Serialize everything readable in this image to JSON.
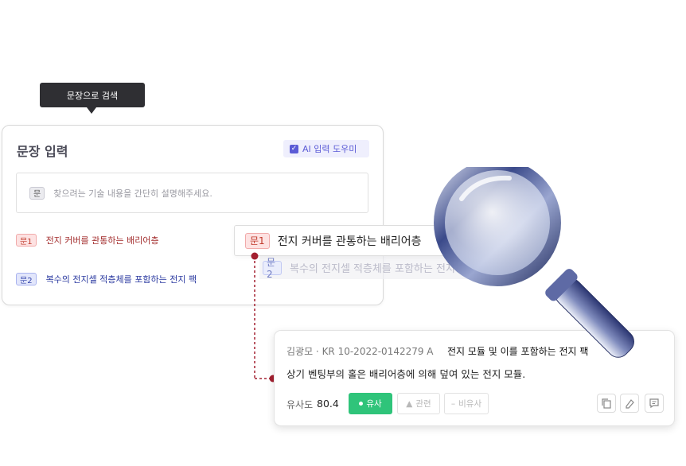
{
  "tooltip": {
    "label": "문장으로 검색"
  },
  "card": {
    "title": "문장 입력",
    "ai_button_label": "AI 입력 도우미",
    "input_tag": "문",
    "input_placeholder": "찾으려는 기술 내용을 간단히 설명해주세요.",
    "sentences": [
      {
        "tag": "문1",
        "text": "전지 커버를 관통하는 배리어층"
      },
      {
        "tag": "문2",
        "text": "복수의 전지셀 적층체를 포함하는 전지 팩"
      }
    ]
  },
  "dropdown": {
    "tag": "문1",
    "text": "전지 커버를 관통하는 배리어층",
    "ghost_tag": "문2",
    "ghost_text": "복수의 전지셀 적층체를 포함하는 전지 팩"
  },
  "result": {
    "meta": "김광모 · KR 10-2022-0142279 A",
    "title": "전지 모듈 및 이를 포함하는 전지 팩",
    "description": "상기 벤팅부의 홀은 배리어층에 의해 덮여 있는 전지 모듈.",
    "similarity_label": "유사도",
    "similarity_value": "80.4",
    "chips": {
      "similar": "유사",
      "related": "관련",
      "dissimilar": "비유사"
    }
  },
  "colors": {
    "accent": "#5b5bd6",
    "similar_green": "#2fc47a",
    "connector_red": "#a32030"
  },
  "icons": [
    "check-icon",
    "chevron-down-icon",
    "copy-icon",
    "highlight-icon",
    "comment-icon",
    "magnifier-icon"
  ]
}
